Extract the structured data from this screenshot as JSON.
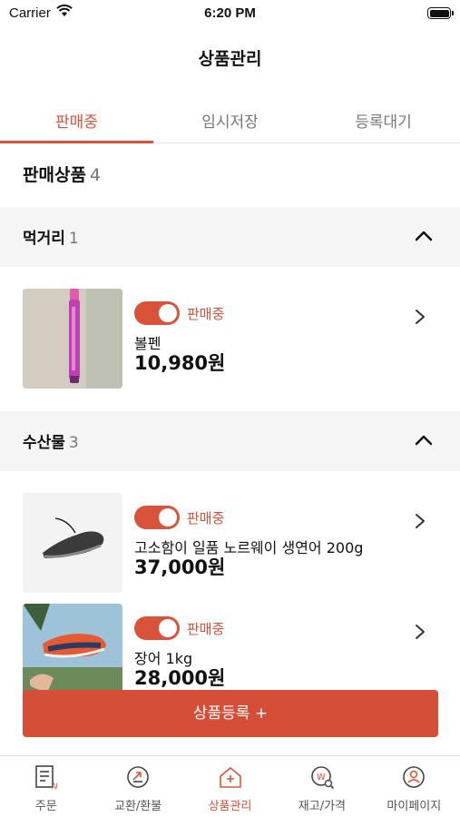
{
  "status_bar": {
    "carrier": "Carrier",
    "time": "6:20 PM"
  },
  "nav": {
    "title": "상품관리"
  },
  "tabs": [
    {
      "label": "판매중",
      "active": true
    },
    {
      "label": "임시저장",
      "active": false
    },
    {
      "label": "등록대기",
      "active": false
    }
  ],
  "section": {
    "title": "판매상품",
    "count": "4"
  },
  "categories": [
    {
      "name": "먹거리",
      "count": "1",
      "products": [
        {
          "status": "판매중",
          "name": "볼펜",
          "price": "10,980원"
        }
      ]
    },
    {
      "name": "수산물",
      "count": "3",
      "products": [
        {
          "status": "판매중",
          "name": "고소함이 일품 노르웨이 생연어 200g",
          "price": "37,000원"
        },
        {
          "status": "판매중",
          "name": "장어 1kg",
          "price": "28,000원"
        }
      ]
    }
  ],
  "register_button": "상품등록 +",
  "tabbar": [
    {
      "label": "주문",
      "icon": "order-icon",
      "active": false
    },
    {
      "label": "교환/환불",
      "icon": "exchange-icon",
      "active": false
    },
    {
      "label": "상품관리",
      "icon": "product-manage-icon",
      "active": true
    },
    {
      "label": "재고/가격",
      "icon": "inventory-price-icon",
      "active": false
    },
    {
      "label": "마이페이지",
      "icon": "mypage-icon",
      "active": false
    }
  ],
  "colors": {
    "accent": "#d9533a",
    "category_bg": "#f5f5f5"
  }
}
